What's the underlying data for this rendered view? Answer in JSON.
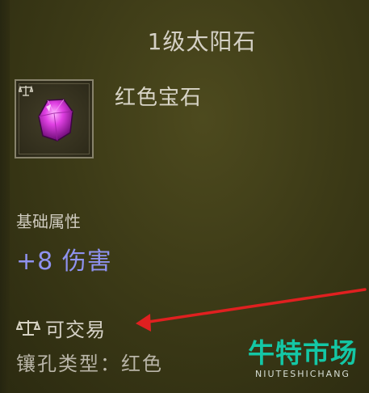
{
  "item": {
    "title": "1级太阳石",
    "gem_type": "红色宝石",
    "gem_color": "#d43bd6"
  },
  "attributes": {
    "section_label": "基础属性",
    "stat": "+8 伤害",
    "stat_color": "#8f92f0"
  },
  "trade": {
    "icon": "scale-icon",
    "label": "可交易"
  },
  "socket": {
    "label": "镶孔类型：红色"
  },
  "annotation": {
    "arrow_color": "#e02020"
  },
  "watermark": {
    "brand": "牛特市场",
    "brand_en": "NIUTESHICHANG",
    "color": "#14c7a6"
  }
}
